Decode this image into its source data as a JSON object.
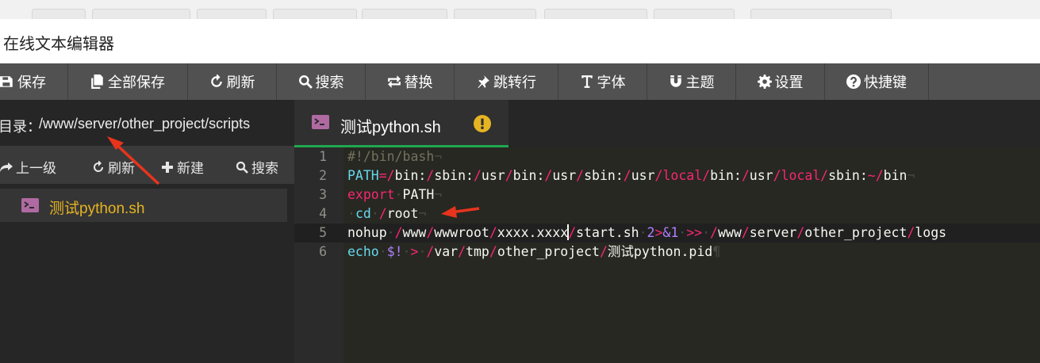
{
  "window": {
    "title": "在线文本编辑器"
  },
  "toolbar": {
    "buttons": [
      {
        "label": "保存",
        "icon": "save-icon"
      },
      {
        "label": "全部保存",
        "icon": "save-all-icon"
      },
      {
        "label": "刷新",
        "icon": "refresh-icon"
      },
      {
        "label": "搜索",
        "icon": "search-icon"
      },
      {
        "label": "替换",
        "icon": "replace-icon"
      },
      {
        "label": "跳转行",
        "icon": "pin-icon"
      },
      {
        "label": "字体",
        "icon": "text-icon"
      },
      {
        "label": "主题",
        "icon": "magnet-icon"
      },
      {
        "label": "设置",
        "icon": "gear-icon"
      },
      {
        "label": "快捷键",
        "icon": "help-icon"
      }
    ]
  },
  "sidebar": {
    "dir_label": "目录：",
    "dir_path": "/www/server/other_project/scripts",
    "tools": [
      {
        "label": "上一级",
        "icon": "share-icon"
      },
      {
        "label": "刷新",
        "icon": "refresh-icon"
      },
      {
        "label": "新建",
        "icon": "plus-icon"
      },
      {
        "label": "搜索",
        "icon": "search-icon"
      }
    ],
    "files": [
      {
        "name": "测试python.sh",
        "icon": "terminal-icon"
      }
    ]
  },
  "editor": {
    "tab": {
      "name": "测试python.sh",
      "status_icon": "warning-icon"
    },
    "line_numbers": [
      "1",
      "2",
      "3",
      "4",
      "5",
      "6"
    ],
    "lines": [
      "#!/bin/bash",
      "PATH=/bin:/sbin:/usr/bin:/usr/sbin:/usr/local/bin:/usr/local/sbin:~/bin",
      "export PATH",
      " cd /root",
      "nohup /www/wwwroot/xxxx.xxxx/start.sh 2>&1 >> /www/server/other_project/logs",
      "echo $! > /var/tmp/other_project/测试python.pid"
    ]
  },
  "colors": {
    "toolbar_bg": "#515151",
    "sidebar_bg": "#262626",
    "editor_bg": "#272822",
    "accent_tab": "#1fa84f",
    "file_name": "#e6b422",
    "keyword": "#f92672",
    "builtin": "#66d9ef",
    "number": "#ae81ff",
    "annotation_arrow": "#e8341c"
  }
}
